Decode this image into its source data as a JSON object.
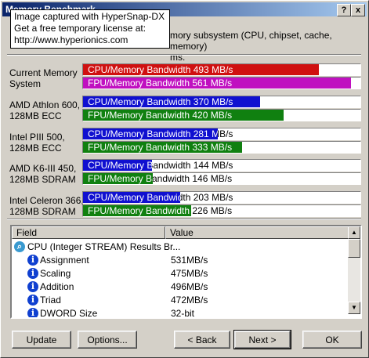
{
  "window": {
    "title": "Memory Benchmark",
    "help_label": "?",
    "close_label": "x"
  },
  "watermark": {
    "line1": "Image captured with HyperSnap-DX",
    "line2": "Get a free temporary license at:",
    "line3": "http://www.hyperionics.com"
  },
  "description": {
    "line1": "mory subsystem (CPU, chipset, cache, memory)",
    "line2": "ms."
  },
  "benchmarks": [
    {
      "label1": "Current Memory",
      "label2": "System",
      "cpu_text": "CPU/Memory Bandwidth 493 MB/s",
      "cpu_value": 493,
      "cpu_color": "#d01010",
      "fpu_text": "FPU/Memory Bandwidth 561 MB/s",
      "fpu_value": 561,
      "fpu_color": "#c010c0"
    },
    {
      "label1": "AMD Athlon 600,",
      "label2": "128MB ECC",
      "cpu_text": "CPU/Memory Bandwidth 370 MB/s",
      "cpu_value": 370,
      "cpu_color": "#1010d0",
      "fpu_text": "FPU/Memory Bandwidth 420 MB/s",
      "fpu_value": 420,
      "fpu_color": "#108010"
    },
    {
      "label1": "Intel PIII 500,",
      "label2": "128MB ECC",
      "cpu_text": "CPU/Memory Bandwidth 281 MB/s",
      "cpu_value": 281,
      "cpu_color": "#1010d0",
      "fpu_text": "FPU/Memory Bandwidth 333 MB/s",
      "fpu_value": 333,
      "fpu_color": "#108010"
    },
    {
      "label1": "AMD K6-III 450,",
      "label2": "128MB SDRAM",
      "cpu_text": "CPU/Memory Bandwidth 144 MB/s",
      "cpu_value": 144,
      "cpu_color": "#1010d0",
      "fpu_text": "FPU/Memory Bandwidth 146 MB/s",
      "fpu_value": 146,
      "fpu_color": "#108010"
    },
    {
      "label1": "Intel Celeron 366,",
      "label2": "128MB SDRAM",
      "cpu_text": "CPU/Memory Bandwidth 203 MB/s",
      "cpu_value": 203,
      "cpu_color": "#1010d0",
      "fpu_text": "FPU/Memory Bandwidth 226 MB/s",
      "fpu_value": 226,
      "fpu_color": "#108010"
    }
  ],
  "bar_max": 580,
  "results": {
    "col_field": "Field",
    "col_value": "Value",
    "rows": [
      {
        "icon": "search-icon",
        "field": "CPU (Integer STREAM) Results Br...",
        "value": ""
      },
      {
        "icon": "info-icon",
        "field": "Assignment",
        "value": "531MB/s"
      },
      {
        "icon": "info-icon",
        "field": "Scaling",
        "value": "475MB/s"
      },
      {
        "icon": "info-icon",
        "field": "Addition",
        "value": "496MB/s"
      },
      {
        "icon": "info-icon",
        "field": "Triad",
        "value": "472MB/s"
      },
      {
        "icon": "info-icon",
        "field": "DWORD Size",
        "value": "32-bit"
      }
    ]
  },
  "buttons": {
    "update": "Update",
    "options": "Options...",
    "back": "< Back",
    "next": "Next >",
    "ok": "OK"
  }
}
